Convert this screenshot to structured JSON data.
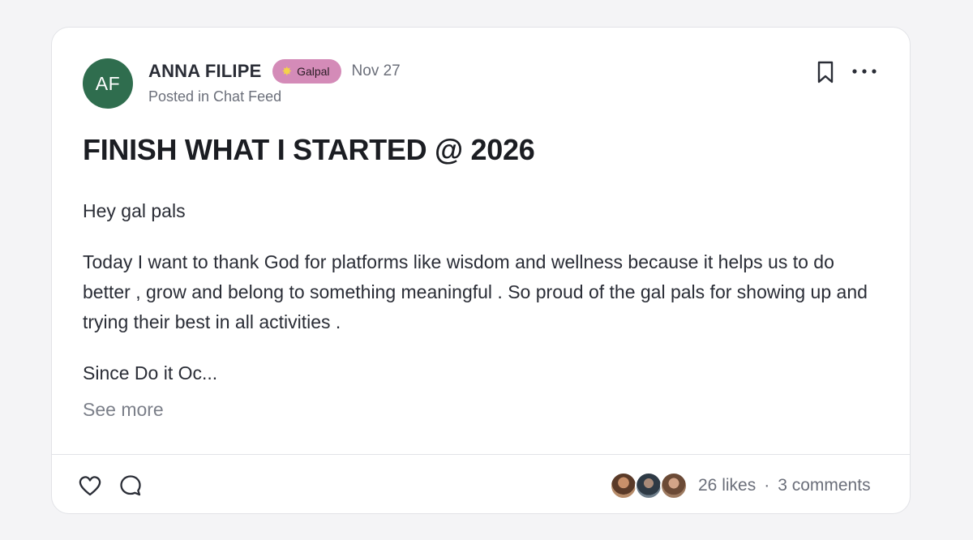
{
  "author": {
    "initials": "AF",
    "name": "ANNA FILIPE",
    "avatar_color": "#2f6d4e"
  },
  "badge": {
    "icon": "sparkle-star-icon",
    "label": "Galpal",
    "color": "#d48bb8"
  },
  "post": {
    "date": "Nov 27",
    "posted_in": "Posted in Chat Feed",
    "title": "FINISH WHAT I STARTED @ 2026",
    "paragraphs": [
      "Hey gal pals",
      "Today I want to thank God for platforms like wisdom and wellness because it helps us to do better , grow and belong to something meaningful . So proud of the gal pals for showing up and trying their best in all activities .",
      "Since Do it Oc..."
    ],
    "see_more": "See more"
  },
  "actions": {
    "bookmark_icon": "bookmark-icon",
    "more_icon": "more-horizontal-icon",
    "like_icon": "heart-icon",
    "comment_icon": "comment-bubble-icon"
  },
  "footer": {
    "likes": "26 likes",
    "separator": "·",
    "comments": "3 comments",
    "reactor_count": 3
  }
}
